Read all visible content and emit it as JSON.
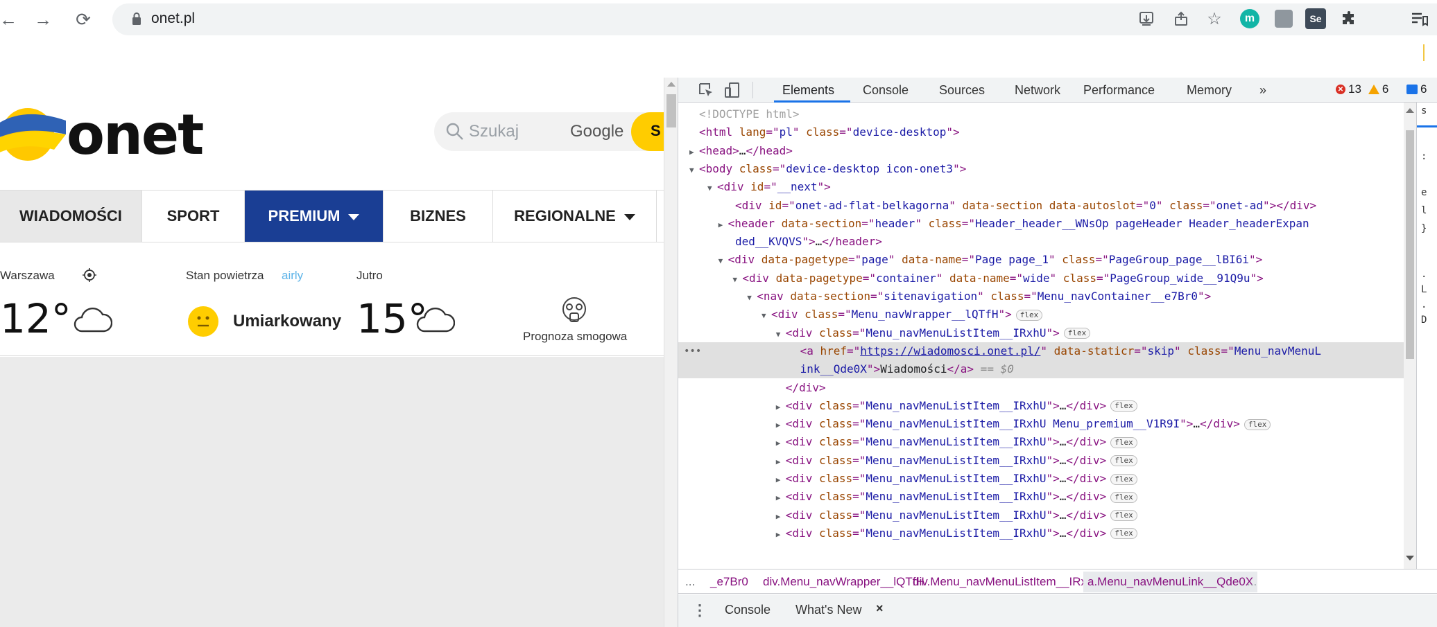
{
  "browser": {
    "url": "onet.pl",
    "icons": [
      "back-icon",
      "forward-icon",
      "reload-icon",
      "lock-icon",
      "install-icon",
      "share-icon",
      "star-icon",
      "extension-m-icon",
      "extension-square-icon",
      "selenium-icon",
      "puzzle-icon",
      "reading-list-icon"
    ],
    "ext_m_label": "m",
    "ext_se_label": "Se"
  },
  "page": {
    "logo_text": "onet",
    "search_placeholder": "Szukaj",
    "search_provider": "Google",
    "search_button": "S",
    "menu": [
      {
        "label": "WIADOMOŚCI",
        "active": true
      },
      {
        "label": "SPORT"
      },
      {
        "label": "PREMIUM",
        "dropdown": true,
        "highlight": true
      },
      {
        "label": "BIZNES"
      },
      {
        "label": "REGIONALNE",
        "dropdown": true
      }
    ],
    "weather": {
      "city": "Warszawa",
      "temp_now": "12°",
      "air_label": "Stan powietrza",
      "air_provider": "airly",
      "air_quality": "Umiarkowany",
      "tomorrow_label": "Jutro",
      "temp_tomorrow": "15°",
      "smog_label": "Prognoza smogowa"
    },
    "colors": {
      "premium_bg": "#1a3e94",
      "accent_yellow": "#ffcc00",
      "ukraine_blue": "#2f62b5"
    }
  },
  "devtools": {
    "tabs": [
      "Elements",
      "Console",
      "Sources",
      "Network",
      "Performance",
      "Memory",
      "»"
    ],
    "active_tab": "Elements",
    "errors": "13",
    "warnings": "6",
    "messages": "6",
    "lines": [
      {
        "indent": 0,
        "tri": "",
        "html": [
          [
            "cm",
            "<!DOCTYPE html>"
          ]
        ]
      },
      {
        "indent": 0,
        "tri": "",
        "html": [
          [
            "tg",
            "<html "
          ],
          [
            "an",
            "lang"
          ],
          [
            "tg",
            "=\""
          ],
          [
            "av",
            "pl"
          ],
          [
            "tg",
            "\" "
          ],
          [
            "an",
            "class"
          ],
          [
            "tg",
            "=\""
          ],
          [
            "av",
            "device-desktop"
          ],
          [
            "tg",
            "\">"
          ]
        ]
      },
      {
        "indent": 0,
        "tri": "▶",
        "html": [
          [
            "tg",
            "<head>"
          ],
          [
            "tx",
            "…"
          ],
          [
            "tg",
            "</head>"
          ]
        ]
      },
      {
        "indent": 0,
        "tri": "▼",
        "html": [
          [
            "tg",
            "<body "
          ],
          [
            "an",
            "class"
          ],
          [
            "tg",
            "=\""
          ],
          [
            "av",
            "device-desktop icon-onet3"
          ],
          [
            "tg",
            "\">"
          ]
        ]
      },
      {
        "indent": 1,
        "tri": "▼",
        "html": [
          [
            "tg",
            "<div "
          ],
          [
            "an",
            "id"
          ],
          [
            "tg",
            "=\""
          ],
          [
            "av",
            "__next"
          ],
          [
            "tg",
            "\">"
          ]
        ]
      },
      {
        "indent": 2,
        "tri": "",
        "html": [
          [
            "tg",
            "<div "
          ],
          [
            "an",
            "id"
          ],
          [
            "tg",
            "=\""
          ],
          [
            "av",
            "onet-ad-flat-belkagorna"
          ],
          [
            "tg",
            "\" "
          ],
          [
            "an",
            "data-section"
          ],
          [
            "tg",
            " "
          ],
          [
            "an",
            "data-autoslot"
          ],
          [
            "tg",
            "=\""
          ],
          [
            "av",
            "0"
          ],
          [
            "tg",
            "\" "
          ],
          [
            "an",
            "class"
          ],
          [
            "tg",
            "=\""
          ],
          [
            "av",
            "onet-ad"
          ],
          [
            "tg",
            "\"></div>"
          ]
        ]
      },
      {
        "indent": 1.6,
        "tri": "▶",
        "html": [
          [
            "tg",
            "<header "
          ],
          [
            "an",
            "data-section"
          ],
          [
            "tg",
            "=\""
          ],
          [
            "av",
            "header"
          ],
          [
            "tg",
            "\" "
          ],
          [
            "an",
            "class"
          ],
          [
            "tg",
            "=\""
          ],
          [
            "av",
            "Header_header__WNsOp pageHeader Header_headerExpan"
          ]
        ]
      },
      {
        "indent": 2,
        "tri": "",
        "html": [
          [
            "av",
            "ded__KVQVS"
          ],
          [
            "tg",
            "\">"
          ],
          [
            "tx",
            "…"
          ],
          [
            "tg",
            "</header>"
          ]
        ]
      },
      {
        "indent": 1.6,
        "tri": "▼",
        "html": [
          [
            "tg",
            "<div "
          ],
          [
            "an",
            "data-pagetype"
          ],
          [
            "tg",
            "=\""
          ],
          [
            "av",
            "page"
          ],
          [
            "tg",
            "\" "
          ],
          [
            "an",
            "data-name"
          ],
          [
            "tg",
            "=\""
          ],
          [
            "av",
            "Page page_1"
          ],
          [
            "tg",
            "\" "
          ],
          [
            "an",
            "class"
          ],
          [
            "tg",
            "=\""
          ],
          [
            "av",
            "PageGroup_page__lBI6i"
          ],
          [
            "tg",
            "\">"
          ]
        ]
      },
      {
        "indent": 2.4,
        "tri": "▼",
        "html": [
          [
            "tg",
            "<div "
          ],
          [
            "an",
            "data-pagetype"
          ],
          [
            "tg",
            "=\""
          ],
          [
            "av",
            "container"
          ],
          [
            "tg",
            "\" "
          ],
          [
            "an",
            "data-name"
          ],
          [
            "tg",
            "=\""
          ],
          [
            "av",
            "wide"
          ],
          [
            "tg",
            "\" "
          ],
          [
            "an",
            "class"
          ],
          [
            "tg",
            "=\""
          ],
          [
            "av",
            "PageGroup_wide__91Q9u"
          ],
          [
            "tg",
            "\">"
          ]
        ]
      },
      {
        "indent": 3.2,
        "tri": "▼",
        "html": [
          [
            "tg",
            "<nav "
          ],
          [
            "an",
            "data-section"
          ],
          [
            "tg",
            "=\""
          ],
          [
            "av",
            "sitenavigation"
          ],
          [
            "tg",
            "\" "
          ],
          [
            "an",
            "class"
          ],
          [
            "tg",
            "=\""
          ],
          [
            "av",
            "Menu_navContainer__e7Br0"
          ],
          [
            "tg",
            "\">"
          ]
        ]
      },
      {
        "indent": 4.0,
        "tri": "▼",
        "html": [
          [
            "tg",
            "<div "
          ],
          [
            "an",
            "class"
          ],
          [
            "tg",
            "=\""
          ],
          [
            "av",
            "Menu_navWrapper__lQTfH"
          ],
          [
            "tg",
            "\">"
          ]
        ],
        "flex": true
      },
      {
        "indent": 4.8,
        "tri": "▼",
        "html": [
          [
            "tg",
            "<div "
          ],
          [
            "an",
            "class"
          ],
          [
            "tg",
            "=\""
          ],
          [
            "av",
            "Menu_navMenuListItem__IRxhU"
          ],
          [
            "tg",
            "\">"
          ]
        ],
        "flex": true
      },
      {
        "indent": 5.6,
        "tri": "",
        "sel": true,
        "html": [
          [
            "tg",
            "<a "
          ],
          [
            "an",
            "href"
          ],
          [
            "tg",
            "=\""
          ],
          [
            "lnk",
            "https://wiadomosci.onet.pl/"
          ],
          [
            "tg",
            "\" "
          ],
          [
            "an",
            "data-staticr"
          ],
          [
            "tg",
            "=\""
          ],
          [
            "av",
            "skip"
          ],
          [
            "tg",
            "\" "
          ],
          [
            "an",
            "class"
          ],
          [
            "tg",
            "=\""
          ],
          [
            "av",
            "Menu_navMenuL"
          ]
        ]
      },
      {
        "indent": 5.6,
        "tri": "",
        "sel": true,
        "html": [
          [
            "av",
            "ink__Qde0X"
          ],
          [
            "tg",
            "\">"
          ],
          [
            "tx",
            "Wiadomości"
          ],
          [
            "tg",
            "</a>"
          ],
          [
            "eq0",
            " == $0"
          ]
        ]
      },
      {
        "indent": 4.8,
        "tri": "",
        "html": [
          [
            "tg",
            "</div>"
          ]
        ]
      },
      {
        "indent": 4.8,
        "tri": "▶",
        "html": [
          [
            "tg",
            "<div "
          ],
          [
            "an",
            "class"
          ],
          [
            "tg",
            "=\""
          ],
          [
            "av",
            "Menu_navMenuListItem__IRxhU"
          ],
          [
            "tg",
            "\">"
          ],
          [
            "tx",
            "…"
          ],
          [
            "tg",
            "</div>"
          ]
        ],
        "flex": true
      },
      {
        "indent": 4.8,
        "tri": "▶",
        "html": [
          [
            "tg",
            "<div "
          ],
          [
            "an",
            "class"
          ],
          [
            "tg",
            "=\""
          ],
          [
            "av",
            "Menu_navMenuListItem__IRxhU Menu_premium__V1R9I"
          ],
          [
            "tg",
            "\">"
          ],
          [
            "tx",
            "…"
          ],
          [
            "tg",
            "</div>"
          ]
        ],
        "flex": true
      },
      {
        "indent": 4.8,
        "tri": "▶",
        "html": [
          [
            "tg",
            "<div "
          ],
          [
            "an",
            "class"
          ],
          [
            "tg",
            "=\""
          ],
          [
            "av",
            "Menu_navMenuListItem__IRxhU"
          ],
          [
            "tg",
            "\">"
          ],
          [
            "tx",
            "…"
          ],
          [
            "tg",
            "</div>"
          ]
        ],
        "flex": true
      },
      {
        "indent": 4.8,
        "tri": "▶",
        "html": [
          [
            "tg",
            "<div "
          ],
          [
            "an",
            "class"
          ],
          [
            "tg",
            "=\""
          ],
          [
            "av",
            "Menu_navMenuListItem__IRxhU"
          ],
          [
            "tg",
            "\">"
          ],
          [
            "tx",
            "…"
          ],
          [
            "tg",
            "</div>"
          ]
        ],
        "flex": true
      },
      {
        "indent": 4.8,
        "tri": "▶",
        "html": [
          [
            "tg",
            "<div "
          ],
          [
            "an",
            "class"
          ],
          [
            "tg",
            "=\""
          ],
          [
            "av",
            "Menu_navMenuListItem__IRxhU"
          ],
          [
            "tg",
            "\">"
          ],
          [
            "tx",
            "…"
          ],
          [
            "tg",
            "</div>"
          ]
        ],
        "flex": true
      },
      {
        "indent": 4.8,
        "tri": "▶",
        "html": [
          [
            "tg",
            "<div "
          ],
          [
            "an",
            "class"
          ],
          [
            "tg",
            "=\""
          ],
          [
            "av",
            "Menu_navMenuListItem__IRxhU"
          ],
          [
            "tg",
            "\">"
          ],
          [
            "tx",
            "…"
          ],
          [
            "tg",
            "</div>"
          ]
        ],
        "flex": true
      },
      {
        "indent": 4.8,
        "tri": "▶",
        "html": [
          [
            "tg",
            "<div "
          ],
          [
            "an",
            "class"
          ],
          [
            "tg",
            "=\""
          ],
          [
            "av",
            "Menu_navMenuListItem__IRxhU"
          ],
          [
            "tg",
            "\">"
          ],
          [
            "tx",
            "…"
          ],
          [
            "tg",
            "</div>"
          ]
        ],
        "flex": true
      },
      {
        "indent": 4.8,
        "tri": "▶",
        "html": [
          [
            "tg",
            "<div "
          ],
          [
            "an",
            "class"
          ],
          [
            "tg",
            "=\""
          ],
          [
            "av",
            "Menu_navMenuListItem__IRxhU"
          ],
          [
            "tg",
            "\">"
          ],
          [
            "tx",
            "…"
          ],
          [
            "tg",
            "</div>"
          ]
        ],
        "flex": true
      }
    ],
    "flex_label": "flex",
    "dots_label": "•••",
    "styles_pane": [
      "s",
      ":",
      "e",
      "l",
      "}",
      ".",
      "L",
      ".",
      "D"
    ],
    "breadcrumbs": [
      "...",
      "_e7Br0",
      "div.Menu_navWrapper__lQTfH",
      "div.Menu_navMenuListItem__IRxhU",
      "a.Menu_navMenuLink__Qde0X",
      "..."
    ],
    "drawer": {
      "kebab": "⋮",
      "tabs": [
        "Console",
        "What's New"
      ],
      "close": "×"
    }
  }
}
